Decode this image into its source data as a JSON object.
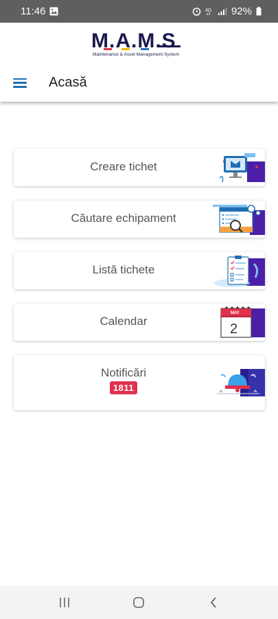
{
  "status_bar": {
    "time": "11:46",
    "battery": "92%"
  },
  "logo": {
    "letters": "M.A.M.S",
    "tagline": "Maintenance & Asset Management System"
  },
  "app_bar": {
    "title": "Acasă"
  },
  "cards": [
    {
      "label": "Creare tichet",
      "icon": "ticket-illustration"
    },
    {
      "label": "Căutare echipament",
      "icon": "equipment-search-illustration"
    },
    {
      "label": "Listă tichete",
      "icon": "ticket-list-illustration"
    },
    {
      "label": "Calendar",
      "icon": "calendar-illustration",
      "month": "MAY",
      "day": "2"
    },
    {
      "label": "Notificări",
      "badge": "1811",
      "icon": "bell-illustration"
    }
  ],
  "colors": {
    "accent": "#1f6fb2",
    "brand_dark": "#1a1a4e",
    "badge": "#e0314d",
    "purple": "#4b1fa8"
  }
}
